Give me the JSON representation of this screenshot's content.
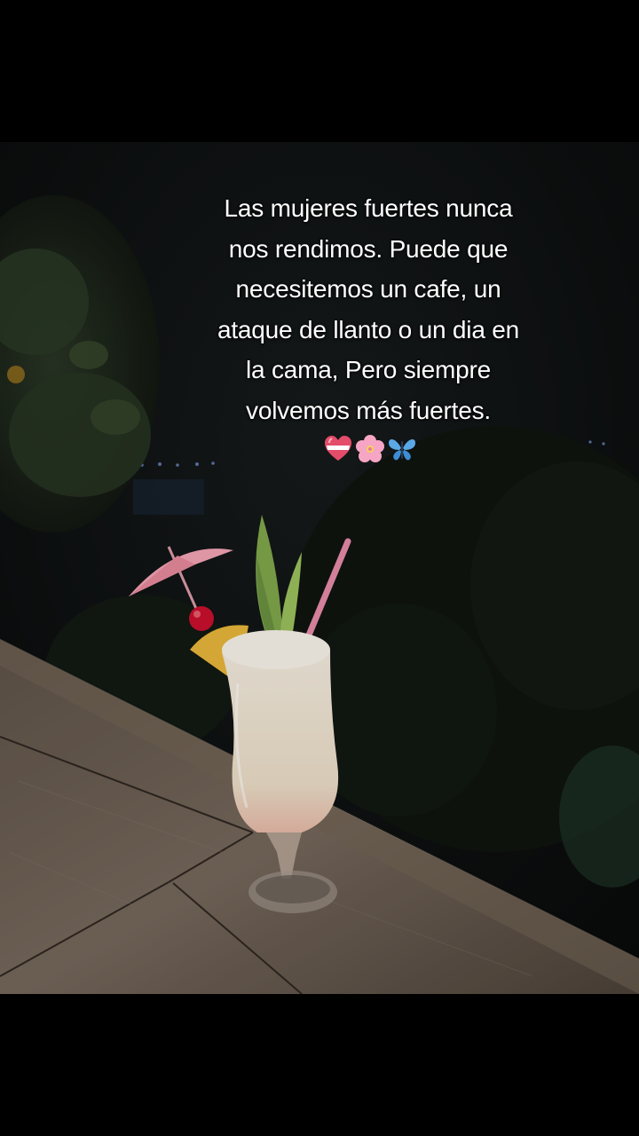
{
  "post": {
    "caption_lines": [
      "Las mujeres fuertes nunca",
      "nos rendimos. Puede que",
      "necesitemos un cafe, un",
      "ataque de llanto o un dia en",
      "la cama, Pero siempre",
      "volvemos más fuertes."
    ],
    "emojis": [
      "heart-ribbon-icon",
      "cherry-blossom-icon",
      "butterfly-icon"
    ]
  },
  "photo": {
    "subject": "cocktail-glass",
    "colors": {
      "sky": "#0c0f10",
      "foliage": "#1f2a1c",
      "table": "#6a5d4f",
      "drink": "#efe6d6",
      "straw": "#e48aa8",
      "umbrella": "#f1a3b3",
      "cherry": "#c8102e",
      "leaf": "#7fa54a"
    }
  }
}
